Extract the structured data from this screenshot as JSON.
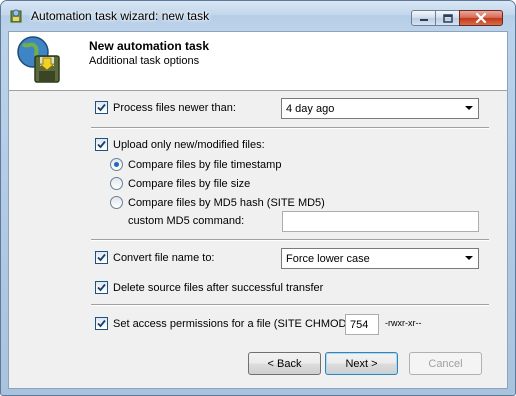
{
  "window": {
    "title": "Automation task wizard: new task",
    "caption_buttons": [
      "minimize-icon",
      "maximize-icon",
      "close-icon"
    ]
  },
  "header": {
    "title": "New automation task",
    "subtitle": "Additional task options",
    "icon": "globe-disk-icon"
  },
  "options": {
    "process_newer": {
      "label": "Process files newer than:",
      "checked": true,
      "selected": "4 day ago"
    },
    "upload_only_new": {
      "label": "Upload only new/modified files:",
      "checked": true
    },
    "compare": [
      {
        "label": "Compare files by file timestamp",
        "selected": true
      },
      {
        "label": "Compare files by file size",
        "selected": false
      },
      {
        "label": "Compare files by MD5 hash (SITE MD5)",
        "selected": false
      }
    ],
    "md5_command": {
      "label": "custom MD5 command:",
      "value": ""
    },
    "convert_name": {
      "label": "Convert file name to:",
      "checked": true,
      "selected": "Force lower case"
    },
    "delete_source": {
      "label": "Delete source files after successful transfer",
      "checked": true
    },
    "permissions": {
      "label": "Set access permissions for a file (SITE CHMOD)",
      "checked": true,
      "value": "754",
      "display": "-rwxr-xr--"
    }
  },
  "buttons": {
    "back": "< Back",
    "next": "Next >",
    "cancel": "Cancel"
  },
  "colors": {
    "accent": "#1d6ab9",
    "title_bar": "#bcd3ea",
    "dialog_bg": "#f0f0f0"
  }
}
